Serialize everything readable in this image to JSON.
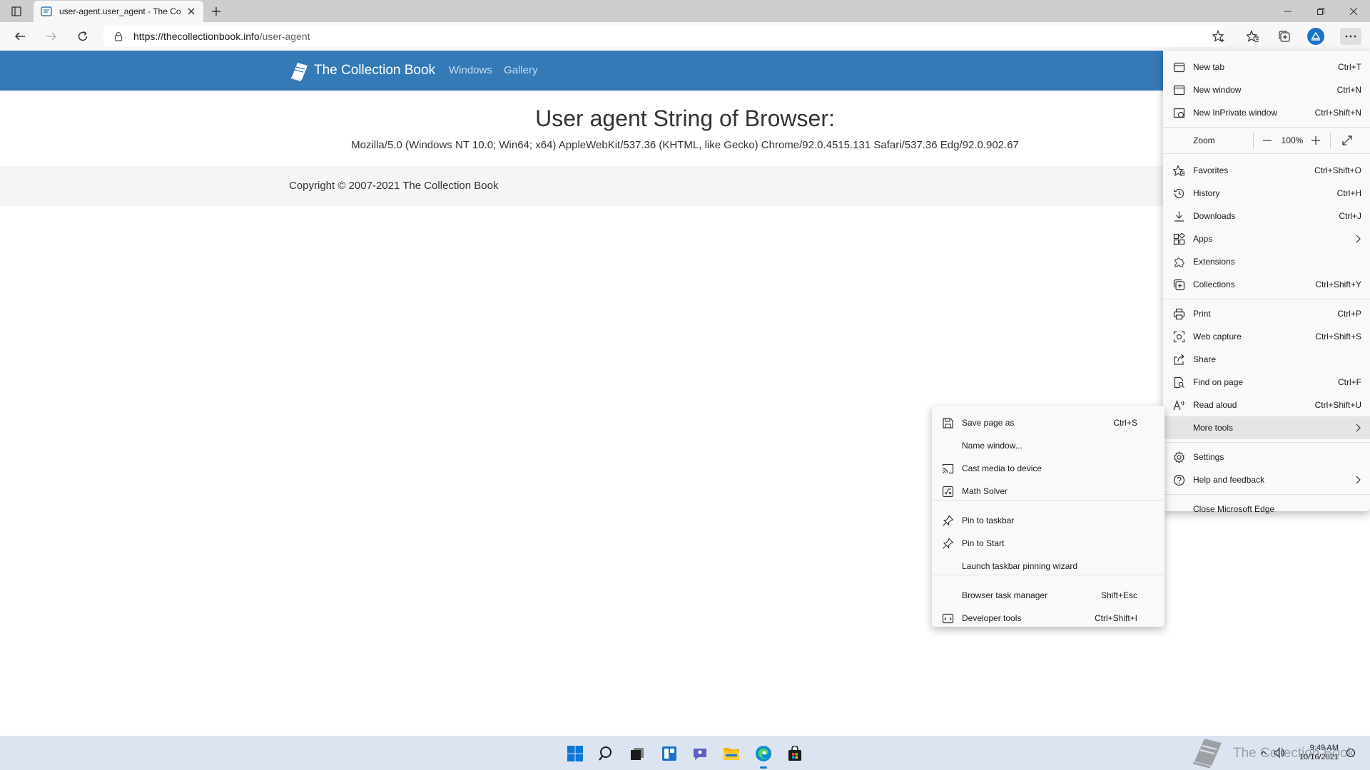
{
  "browser": {
    "tab_title": "user-agent.user_agent - The Col",
    "url_host": "https://thecollectionbook.info",
    "url_path": "/user-agent"
  },
  "site": {
    "brand": "The Collection Book",
    "nav": [
      "Windows",
      "Gallery"
    ],
    "headline": "User agent String of Browser:",
    "ua_string": "Mozilla/5.0 (Windows NT 10.0; Win64; x64) AppleWebKit/537.36 (KHTML, like Gecko) Chrome/92.0.4515.131 Safari/537.36 Edg/92.0.902.67",
    "copyright": "Copyright © 2007-2021 The Collection Book"
  },
  "menu": {
    "new_tab": {
      "label": "New tab",
      "shortcut": "Ctrl+T"
    },
    "new_window": {
      "label": "New window",
      "shortcut": "Ctrl+N"
    },
    "new_inprivate": {
      "label": "New InPrivate window",
      "shortcut": "Ctrl+Shift+N"
    },
    "zoom": {
      "label": "Zoom",
      "value": "100%"
    },
    "favorites": {
      "label": "Favorites",
      "shortcut": "Ctrl+Shift+O"
    },
    "history": {
      "label": "History",
      "shortcut": "Ctrl+H"
    },
    "downloads": {
      "label": "Downloads",
      "shortcut": "Ctrl+J"
    },
    "apps": {
      "label": "Apps"
    },
    "extensions": {
      "label": "Extensions"
    },
    "collections": {
      "label": "Collections",
      "shortcut": "Ctrl+Shift+Y"
    },
    "print": {
      "label": "Print",
      "shortcut": "Ctrl+P"
    },
    "web_capture": {
      "label": "Web capture",
      "shortcut": "Ctrl+Shift+S"
    },
    "share": {
      "label": "Share"
    },
    "find": {
      "label": "Find on page",
      "shortcut": "Ctrl+F"
    },
    "read_aloud": {
      "label": "Read aloud",
      "shortcut": "Ctrl+Shift+U"
    },
    "more_tools": {
      "label": "More tools"
    },
    "settings": {
      "label": "Settings"
    },
    "help": {
      "label": "Help and feedback"
    },
    "close": {
      "label": "Close Microsoft Edge"
    }
  },
  "submenu": {
    "save_page": {
      "label": "Save page as",
      "shortcut": "Ctrl+S"
    },
    "name_window": {
      "label": "Name window..."
    },
    "cast": {
      "label": "Cast media to device"
    },
    "math": {
      "label": "Math Solver"
    },
    "pin_taskbar": {
      "label": "Pin to taskbar"
    },
    "pin_start": {
      "label": "Pin to Start"
    },
    "pin_wizard": {
      "label": "Launch taskbar pinning wizard"
    },
    "task_manager": {
      "label": "Browser task manager",
      "shortcut": "Shift+Esc"
    },
    "dev_tools": {
      "label": "Developer tools",
      "shortcut": "Ctrl+Shift+I"
    }
  },
  "taskbar": {
    "time": "9:49 AM",
    "date": "10/16/2021",
    "watermark": "The Collection Book"
  },
  "colors": {
    "header_blue": "#337ab7",
    "taskbar": "#dbe4f0",
    "menu_bg": "#f9f9f9"
  }
}
